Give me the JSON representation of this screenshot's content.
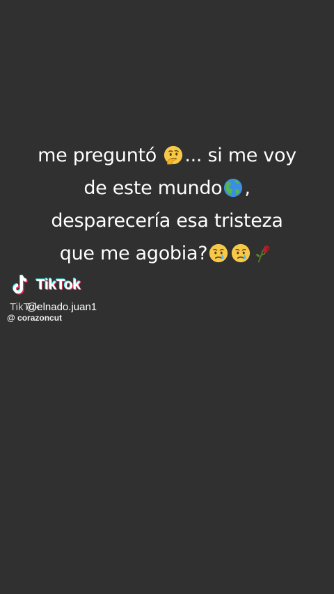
{
  "caption": {
    "line1_a": "me preguntó ",
    "line1_b": "... si me voy",
    "line2": "de este mundo",
    "line2_end": ",",
    "line3": "desparecería esa tristeza",
    "line4": "que me agobia?"
  },
  "emojis": [
    "thinking-face",
    "globe-americas",
    "crying-face",
    "crying-face",
    "wilted-flower"
  ],
  "watermark": {
    "brand": "TikTok",
    "overlap_text": "TikTok",
    "username": "@elnado.juan1",
    "handle": "@ corazoncut"
  },
  "colors": {
    "background": "#303030",
    "text": "#ffffff",
    "tiktok_cyan": "#25f4ee",
    "tiktok_pink": "#fe2c55"
  }
}
